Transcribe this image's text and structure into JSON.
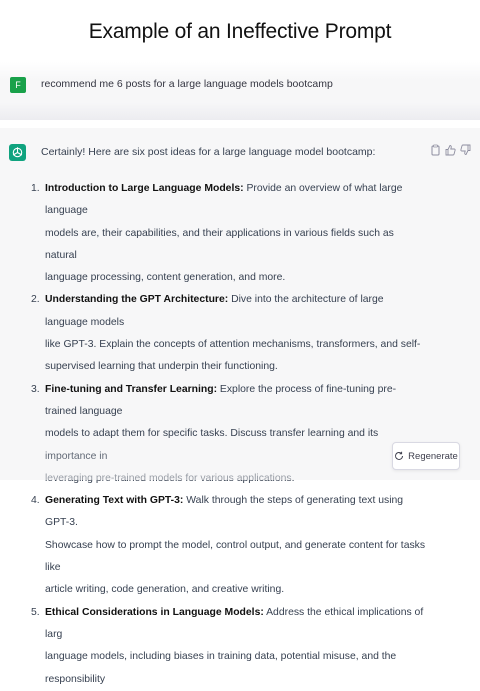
{
  "title": "Example of an Ineffective Prompt",
  "user": {
    "avatar_initial": "F",
    "message": "recommend me 6 posts for a large language models bootcamp"
  },
  "assistant": {
    "intro": "Certainly! Here are six post ideas for a large language model bootcamp:",
    "items": [
      {
        "num": "1.",
        "heading": "Introduction to Large Language Models:",
        "lines": [
          " Provide an overview of what large language",
          "models are, their capabilities, and their applications in various fields such as natural",
          "language processing, content generation, and more."
        ]
      },
      {
        "num": "2.",
        "heading": "Understanding the GPT Architecture:",
        "lines": [
          " Dive into the architecture of large language models",
          "like GPT-3. Explain the concepts of attention mechanisms, transformers, and self-",
          "supervised learning that underpin their functioning."
        ]
      },
      {
        "num": "3.",
        "heading": "Fine-tuning and Transfer Learning:",
        "lines": [
          " Explore the process of fine-tuning pre-trained language",
          "models to adapt them for specific tasks. Discuss transfer learning and its importance in",
          "leveraging pre-trained models for various applications."
        ]
      },
      {
        "num": "4.",
        "heading": "Generating Text with GPT-3:",
        "lines": [
          " Walk through the steps of generating text using GPT-3.",
          "Showcase how to prompt the model, control output, and generate content for tasks like",
          "article writing, code generation, and creative writing."
        ]
      },
      {
        "num": "5.",
        "heading": "Ethical Considerations in Language Models:",
        "lines": [
          " Address the ethical implications of larg",
          "language models, including biases in training data, potential misuse, and the responsibility"
        ]
      }
    ]
  },
  "actions": {
    "copy_icon": "clipboard-icon",
    "like_icon": "thumbs-up-icon",
    "dislike_icon": "thumbs-down-icon"
  },
  "regenerate": {
    "label": "Regenerate",
    "icon": "refresh-icon"
  },
  "colors": {
    "user_avatar": "#19a14a",
    "assistant_avatar": "#10a37f",
    "assistant_bg": "#f7f7f8"
  }
}
